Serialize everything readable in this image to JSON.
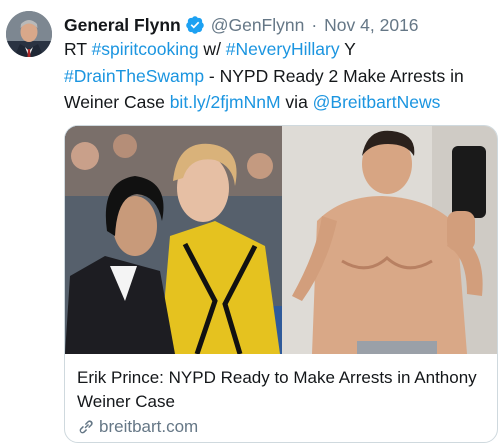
{
  "author": {
    "display_name": "General Flynn",
    "handle": "@GenFlynn",
    "separator": "·",
    "date": "Nov 4, 2016",
    "verified_icon": "verified-badge-icon"
  },
  "tweet": {
    "segments": [
      {
        "text": "RT ",
        "kind": "text"
      },
      {
        "text": "#spiritcooking",
        "kind": "link"
      },
      {
        "text": " w/ ",
        "kind": "text"
      },
      {
        "text": "#NeveryHillary",
        "kind": "link"
      },
      {
        "text": " Y ",
        "kind": "text"
      },
      {
        "text": "#DrainTheSwamp",
        "kind": "link"
      },
      {
        "text": " - NYPD Ready 2 Make Arrests in Weiner Case ",
        "kind": "text"
      },
      {
        "text": "bit.ly/2fjmNnM",
        "kind": "link"
      },
      {
        "text": " via ",
        "kind": "text"
      },
      {
        "text": "@BreitbartNews",
        "kind": "link"
      }
    ]
  },
  "card": {
    "title": "Erik Prince: NYPD Ready to Make Arrests in Anthony Weiner Case",
    "domain": "breitbart.com",
    "domain_icon": "link-icon"
  },
  "colors": {
    "link": "#1b95e0",
    "secondary_text": "#657786",
    "verified": "#1da1f2",
    "card_border": "#cfd9de"
  }
}
